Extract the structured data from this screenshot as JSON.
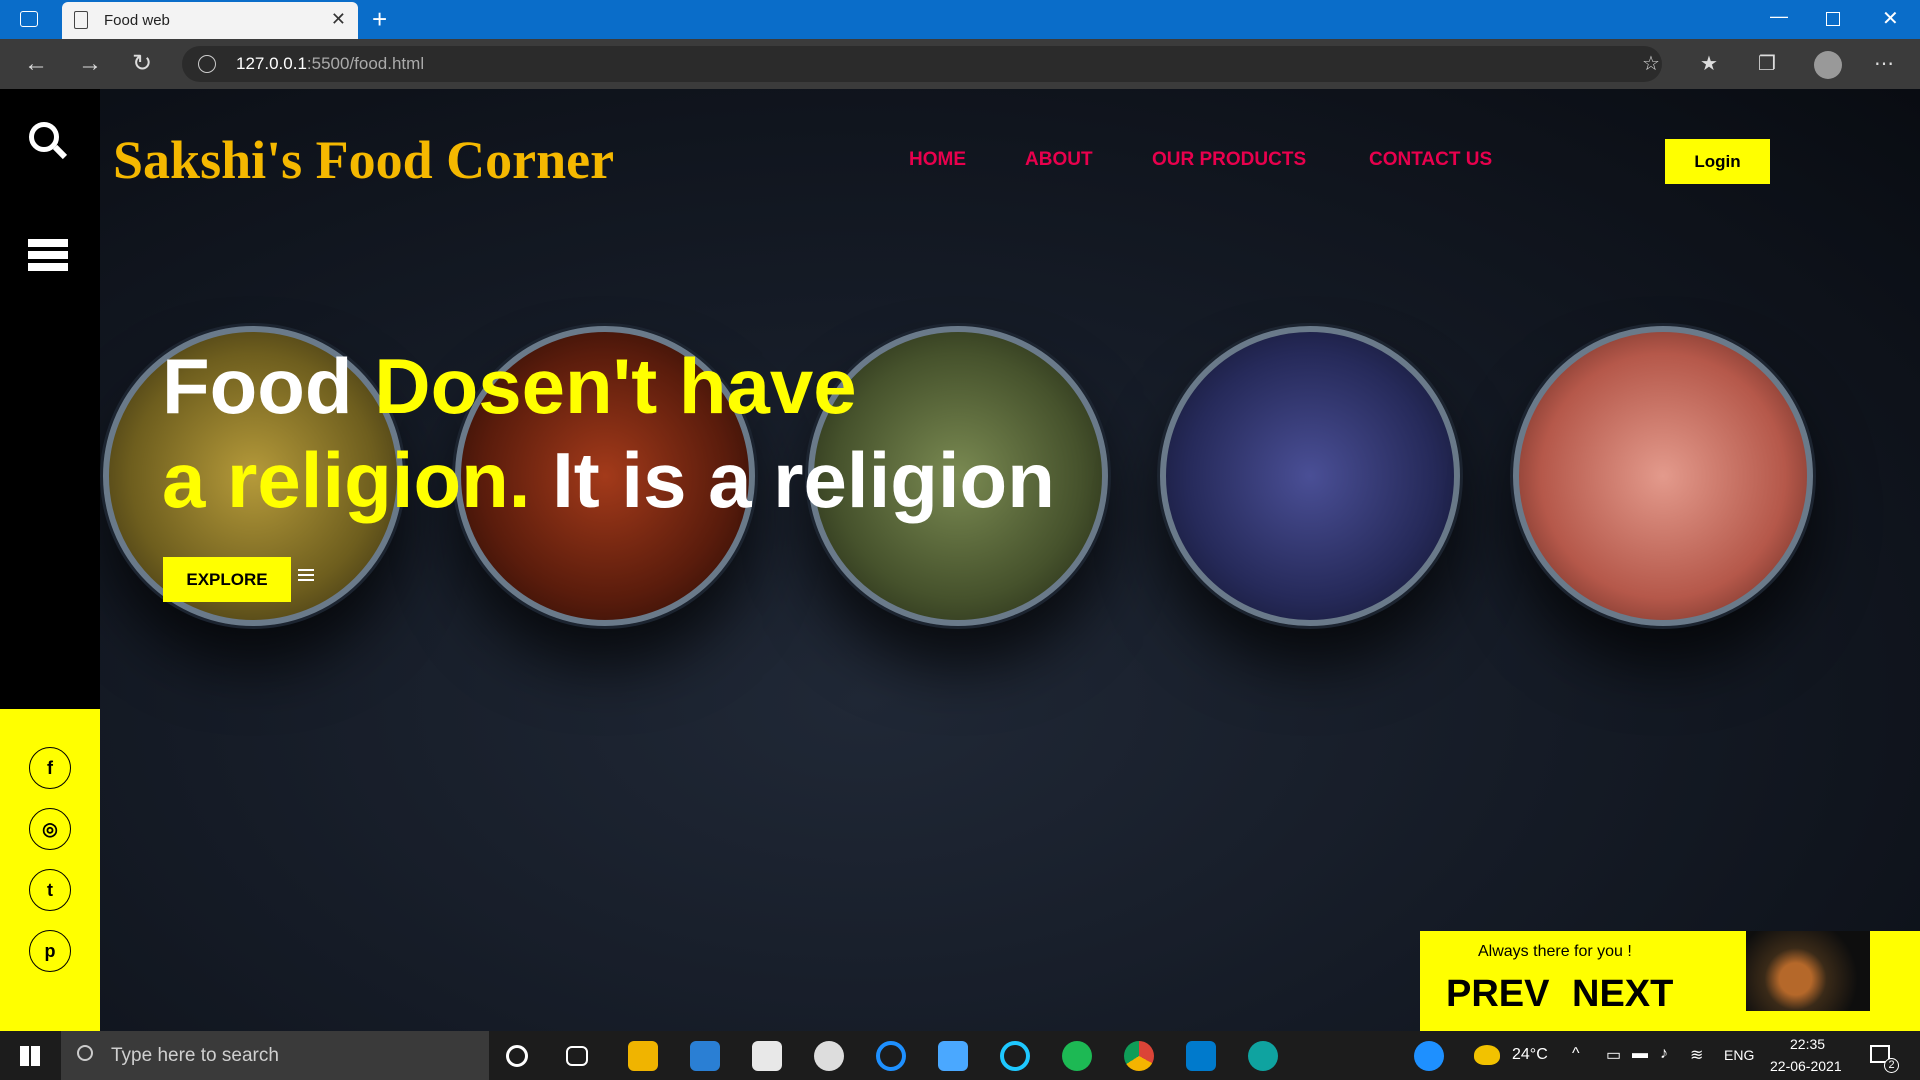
{
  "browser": {
    "tab_title": "Food web",
    "url_host": "127.0.0.1",
    "url_rest": ":5500/food.html"
  },
  "site": {
    "brand": "Sakshi's Food Corner",
    "nav": [
      "HOME",
      "ABOUT",
      "OUR PRODUCTS",
      "CONTACT US"
    ],
    "login": "Login",
    "headline_1": "Food",
    "headline_2": "Dosen't have",
    "headline_3": "a religion.",
    "headline_4": "It is a religion",
    "explore": "EXPLORE",
    "panel_tag": "Always there for you !",
    "prev": "PREV",
    "next": "NEXT"
  },
  "taskbar": {
    "search_placeholder": "Type here to search",
    "temp": "24°C",
    "lang": "ENG",
    "time": "22:35",
    "date": "22-06-2021",
    "notif_count": "2"
  },
  "colors": {
    "accent": "#ffff00",
    "nav": "#e8004d",
    "brand": "#f5b800",
    "titlebar": "#0a6dc9"
  }
}
